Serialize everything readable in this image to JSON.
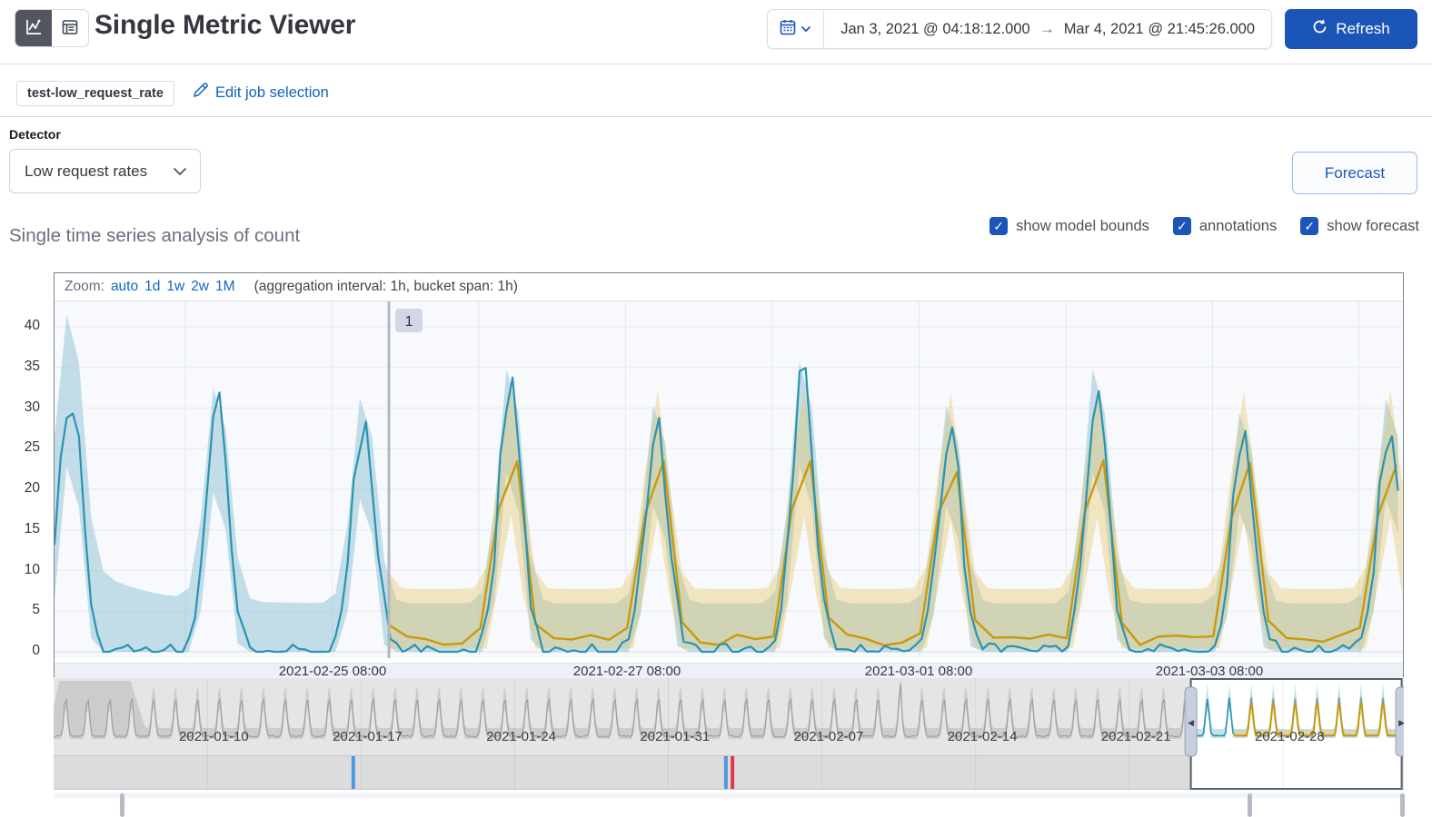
{
  "header": {
    "title": "Single Metric Viewer",
    "refresh_label": "Refresh",
    "time_range": {
      "start": "Jan 3, 2021 @ 04:18:12.000",
      "arrow": "→",
      "end": "Mar 4, 2021 @ 21:45:26.000"
    }
  },
  "job_bar": {
    "job_name": "test-low_request_rate",
    "edit_label": "Edit job selection"
  },
  "controls": {
    "detector_label": "Detector",
    "detector_value": "Low request rates",
    "forecast_label": "Forecast"
  },
  "analysis": {
    "heading": "Single time series analysis of count",
    "checkboxes": [
      {
        "label": "show model bounds",
        "checked": true
      },
      {
        "label": "annotations",
        "checked": true
      },
      {
        "label": "show forecast",
        "checked": true
      }
    ],
    "check_glyph": "✓"
  },
  "colors": {
    "accent": "#1b55b8",
    "link": "#0e63c4",
    "actual_line": "#2b93b1",
    "model_band": "rgba(108,176,200,0.38)",
    "forecast_line": "#c9990b",
    "forecast_band": "rgba(233,198,106,0.40)",
    "context_line": "#9aa0a5",
    "context_band": "rgba(0,0,0,0.105)",
    "annotation_blue": "#4b97e4",
    "annotation_red": "#e0374d"
  },
  "chart_data": [
    {
      "id": "focus",
      "type": "line",
      "toolbar": {
        "zoom_label": "Zoom:",
        "zoom_options": [
          "auto",
          "1d",
          "1w",
          "2w",
          "1M"
        ],
        "aggregation_note": "(aggregation interval: 1h, bucket span: 1h)"
      },
      "y_ticks": [
        0,
        5,
        10,
        15,
        20,
        25,
        30,
        35,
        40
      ],
      "ylim": [
        0,
        43.2
      ],
      "x_tick_labels": [
        "2021-02-25 08:00",
        "2021-02-27 08:00",
        "2021-03-01 08:00",
        "2021-03-03 08:00"
      ],
      "x_tick_fracs": [
        0.206,
        0.4248,
        0.6406,
        0.8564
      ],
      "day_frac": 0.1088,
      "total_days": 9.2,
      "peak_phase": 0.11,
      "trough": 0.8,
      "annotation": {
        "label": "1",
        "frac": 0.248
      },
      "series": [
        {
          "name": "actual",
          "daily_peaks": [
            34,
            30,
            29,
            33,
            28,
            34,
            28,
            33,
            27,
            29
          ]
        },
        {
          "name": "forecast",
          "start_frac": 0.248,
          "daily_peaks": [
            27,
            27.5,
            27,
            27.8,
            27.2,
            27.5,
            27,
            27.4,
            27.1,
            27.3
          ]
        }
      ],
      "legend_position": "none",
      "grid": true
    },
    {
      "id": "context",
      "type": "line",
      "x_tick_labels": [
        "2021-01-10",
        "2021-01-17",
        "2021-01-24",
        "2021-01-31",
        "2021-02-07",
        "2021-02-14",
        "2021-02-21",
        "2021-02-28"
      ],
      "x_tick_days": [
        7,
        14,
        21,
        28,
        35,
        42,
        49,
        56
      ],
      "total_days": 61.5,
      "peak_phase": 0.55,
      "learning_period_end_day": 3.5,
      "spike_day": 38.6,
      "brush": {
        "start_day": 51.8,
        "end_day": 61.4
      },
      "forecast_start_day": 53.75,
      "annotation_markers": [
        {
          "color": "blue",
          "day": 13.65
        },
        {
          "color": "blue",
          "day": 30.62
        },
        {
          "color": "red",
          "day": 30.92
        }
      ],
      "scrollbar_pill_fracs": [
        0.0502,
        0.8856,
        0.9985
      ]
    }
  ]
}
